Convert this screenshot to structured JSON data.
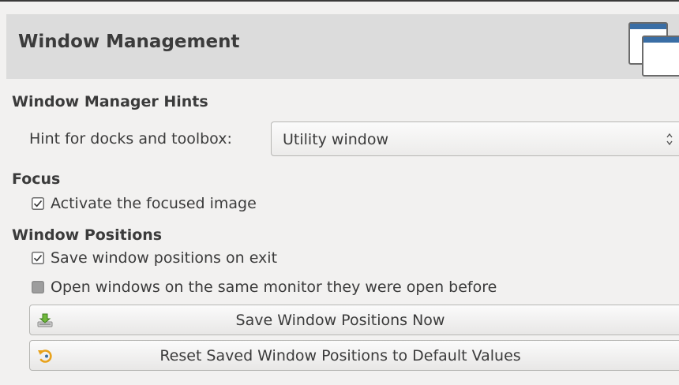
{
  "page": {
    "title": "Window Management",
    "icon": "windows-icon"
  },
  "hints": {
    "section_title": "Window Manager Hints",
    "dock_hint_label": "Hint for docks and toolbox:",
    "dock_hint_value": "Utility window"
  },
  "focus": {
    "section_title": "Focus",
    "activate_focused_image": {
      "label": "Activate the focused image",
      "checked": true
    }
  },
  "positions": {
    "section_title": "Window Positions",
    "save_on_exit": {
      "label": "Save window positions on exit",
      "checked": true
    },
    "same_monitor": {
      "label": "Open windows on the same monitor they were open before",
      "checked": false
    },
    "save_now_button": {
      "label": "Save Window Positions Now",
      "icon": "save-download-icon"
    },
    "reset_button": {
      "label": "Reset Saved Window Positions to Default Values",
      "icon": "reset-icon"
    }
  }
}
